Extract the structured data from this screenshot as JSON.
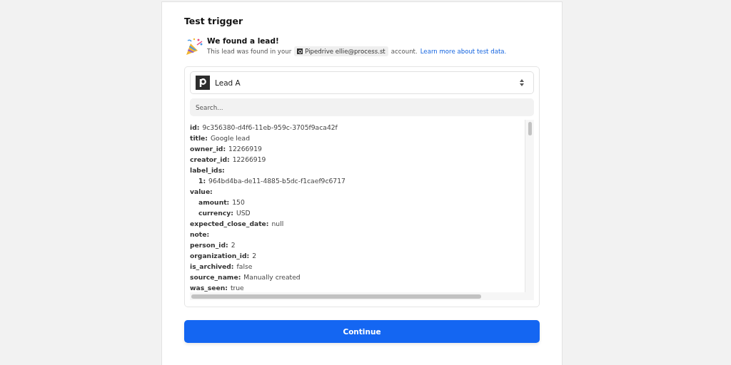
{
  "heading": "Test trigger",
  "notice": {
    "title": "We found a lead!",
    "text_before": "This lead was found in your",
    "account": "Pipedrive ellie@process.st",
    "text_after": "account.",
    "link": "Learn more about test data."
  },
  "record_select": {
    "value": "Lead A"
  },
  "search": {
    "placeholder": "Search..."
  },
  "fields": [
    {
      "key": "id:",
      "value": "9c356380-d4f6-11eb-959c-3705f9aca42f"
    },
    {
      "key": "title:",
      "value": "Google lead"
    },
    {
      "key": "owner_id:",
      "value": "12266919"
    },
    {
      "key": "creator_id:",
      "value": "12266919"
    },
    {
      "key": "label_ids:",
      "children": [
        {
          "key": "1:",
          "value": "964bd4ba-de11-4885-b5dc-f1caef9c6717"
        }
      ]
    },
    {
      "key": "value:",
      "children": [
        {
          "key": "amount:",
          "value": "150"
        },
        {
          "key": "currency:",
          "value": "USD"
        }
      ]
    },
    {
      "key": "expected_close_date:",
      "value": "null"
    },
    {
      "key": "note:"
    },
    {
      "key": "person_id:",
      "value": "2"
    },
    {
      "key": "organization_id:",
      "value": "2"
    },
    {
      "key": "is_archived:",
      "value": "false"
    },
    {
      "key": "source_name:",
      "value": "Manually created"
    },
    {
      "key": "was_seen:",
      "value": "true"
    }
  ],
  "continue_button": "Continue"
}
